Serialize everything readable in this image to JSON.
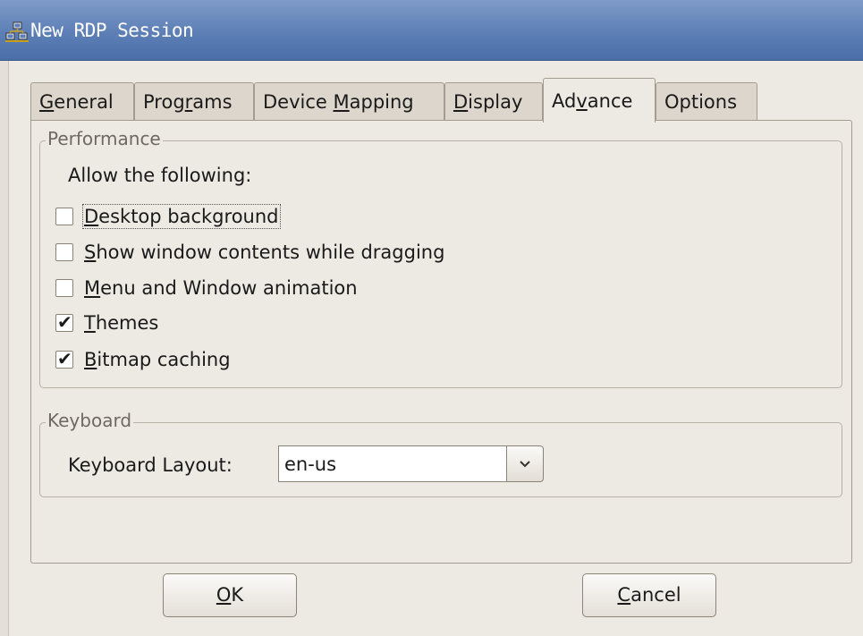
{
  "window": {
    "title": "New RDP Session",
    "icon": "network-computers-icon"
  },
  "tabs": [
    {
      "pre": "",
      "key": "G",
      "post": "eneral"
    },
    {
      "pre": "Prog",
      "key": "r",
      "post": "ams"
    },
    {
      "pre": "Device ",
      "key": "M",
      "post": "apping"
    },
    {
      "pre": "",
      "key": "D",
      "post": "isplay"
    },
    {
      "pre": "Ad",
      "key": "v",
      "post": "ance"
    },
    {
      "pre": "Options",
      "key": "",
      "post": ""
    }
  ],
  "active_tab": "Advance",
  "performance": {
    "label": "Performance",
    "allow_label": "Allow the following:",
    "options": [
      {
        "key": "D",
        "rest": "esktop background",
        "checked": false
      },
      {
        "key": "S",
        "rest": "how window contents while dragging",
        "checked": false
      },
      {
        "key": "M",
        "rest": "enu and Window animation",
        "checked": false
      },
      {
        "key": "T",
        "rest": "hemes",
        "checked": true
      },
      {
        "key": "B",
        "rest": "itmap caching",
        "checked": true
      }
    ],
    "checkmark": "✔"
  },
  "keyboard": {
    "label": "Keyboard",
    "layout_label": "Keyboard Layout:",
    "layout_value": "en-us"
  },
  "buttons": {
    "ok": {
      "key": "O",
      "rest": "K"
    },
    "cancel": {
      "key": "C",
      "rest": "ancel"
    }
  }
}
